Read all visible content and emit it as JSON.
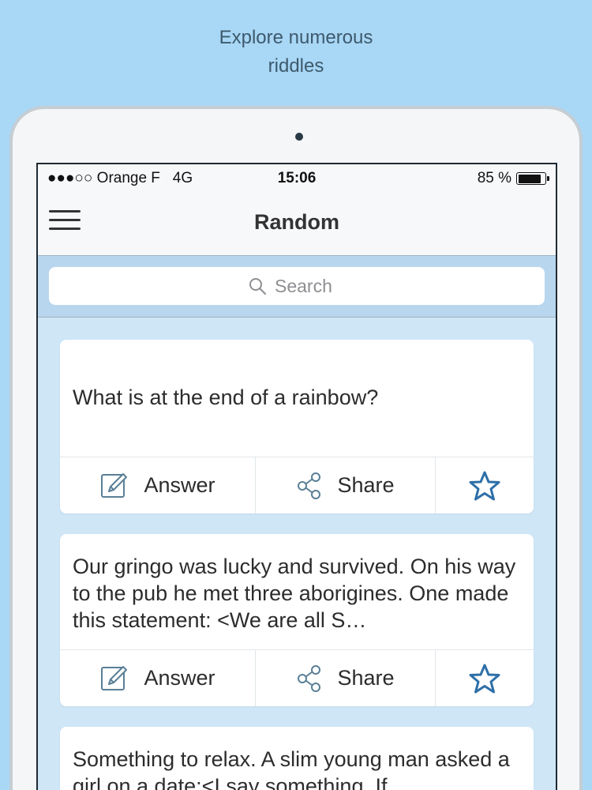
{
  "promo": {
    "line1": "Explore numerous",
    "line2": "riddles"
  },
  "status_bar": {
    "carrier": "●●●○○ Orange F",
    "network": "4G",
    "time": "15:06",
    "battery_text": "85 %",
    "battery_level": 0.85
  },
  "nav": {
    "title": "Random",
    "menu_icon": "hamburger-menu-icon"
  },
  "search": {
    "placeholder": "Search",
    "value": ""
  },
  "actions": {
    "answer_label": "Answer",
    "share_label": "Share"
  },
  "riddles": [
    {
      "text": "What is at the end of a rainbow?"
    },
    {
      "text": "Our gringo was lucky and survived. On his way to the pub he met three aborigines. One made this statement: <We are all S…"
    },
    {
      "text": "Something to relax. A slim young man asked a girl on a date:<I say something. If"
    }
  ],
  "colors": {
    "background": "#a9d7f6",
    "accent": "#2d6fa8",
    "icon": "#5a7f96"
  }
}
